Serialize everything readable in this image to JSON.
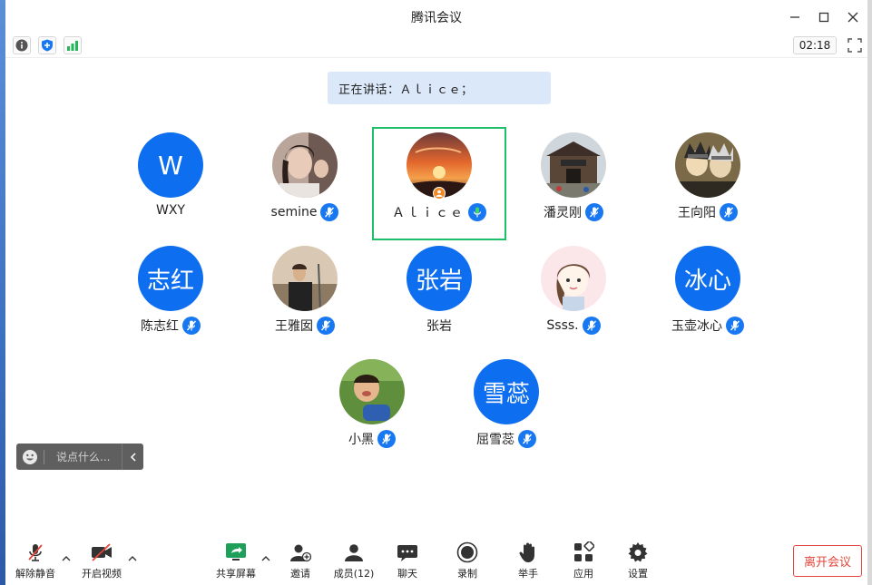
{
  "window": {
    "title": "腾讯会议"
  },
  "infobar": {
    "timer": "02:18"
  },
  "speaking": {
    "text": "正在讲话：Ａｌｉｃｅ；"
  },
  "participants": [
    {
      "name": "WXY",
      "avatar_text": "W",
      "avatar_type": "letter"
    },
    {
      "name": "semine",
      "avatar_type": "photo"
    },
    {
      "name": "Ａｌｉｃｅ",
      "avatar_type": "photo",
      "active": true
    },
    {
      "name": "潘灵刚",
      "avatar_type": "photo"
    },
    {
      "name": "王向阳",
      "avatar_type": "photo"
    },
    {
      "name": "陈志红",
      "avatar_text": "志红",
      "avatar_type": "text"
    },
    {
      "name": "王雅囡",
      "avatar_type": "photo"
    },
    {
      "name": "张岩",
      "avatar_text": "张岩",
      "avatar_type": "text"
    },
    {
      "name": "Ssss.",
      "avatar_type": "photo"
    },
    {
      "name": "玉壶冰心",
      "avatar_text": "冰心",
      "avatar_type": "text"
    },
    {
      "name": "小黑",
      "avatar_type": "photo"
    },
    {
      "name": "屈雪蕊",
      "avatar_text": "雪蕊",
      "avatar_type": "text"
    }
  ],
  "chat": {
    "placeholder": "说点什么..."
  },
  "toolbar": {
    "unmute": "解除静音",
    "start_video": "开启视频",
    "share_screen": "共享屏幕",
    "invite": "邀请",
    "members": "成员(12)",
    "chat": "聊天",
    "record": "录制",
    "raise_hand": "举手",
    "apps": "应用",
    "settings": "设置",
    "leave": "离开会议"
  },
  "colors": {
    "accent": "#0e6ef0",
    "active_border": "#1fbf6a",
    "leave": "#e3453a",
    "banner": "#dbe8f9"
  }
}
